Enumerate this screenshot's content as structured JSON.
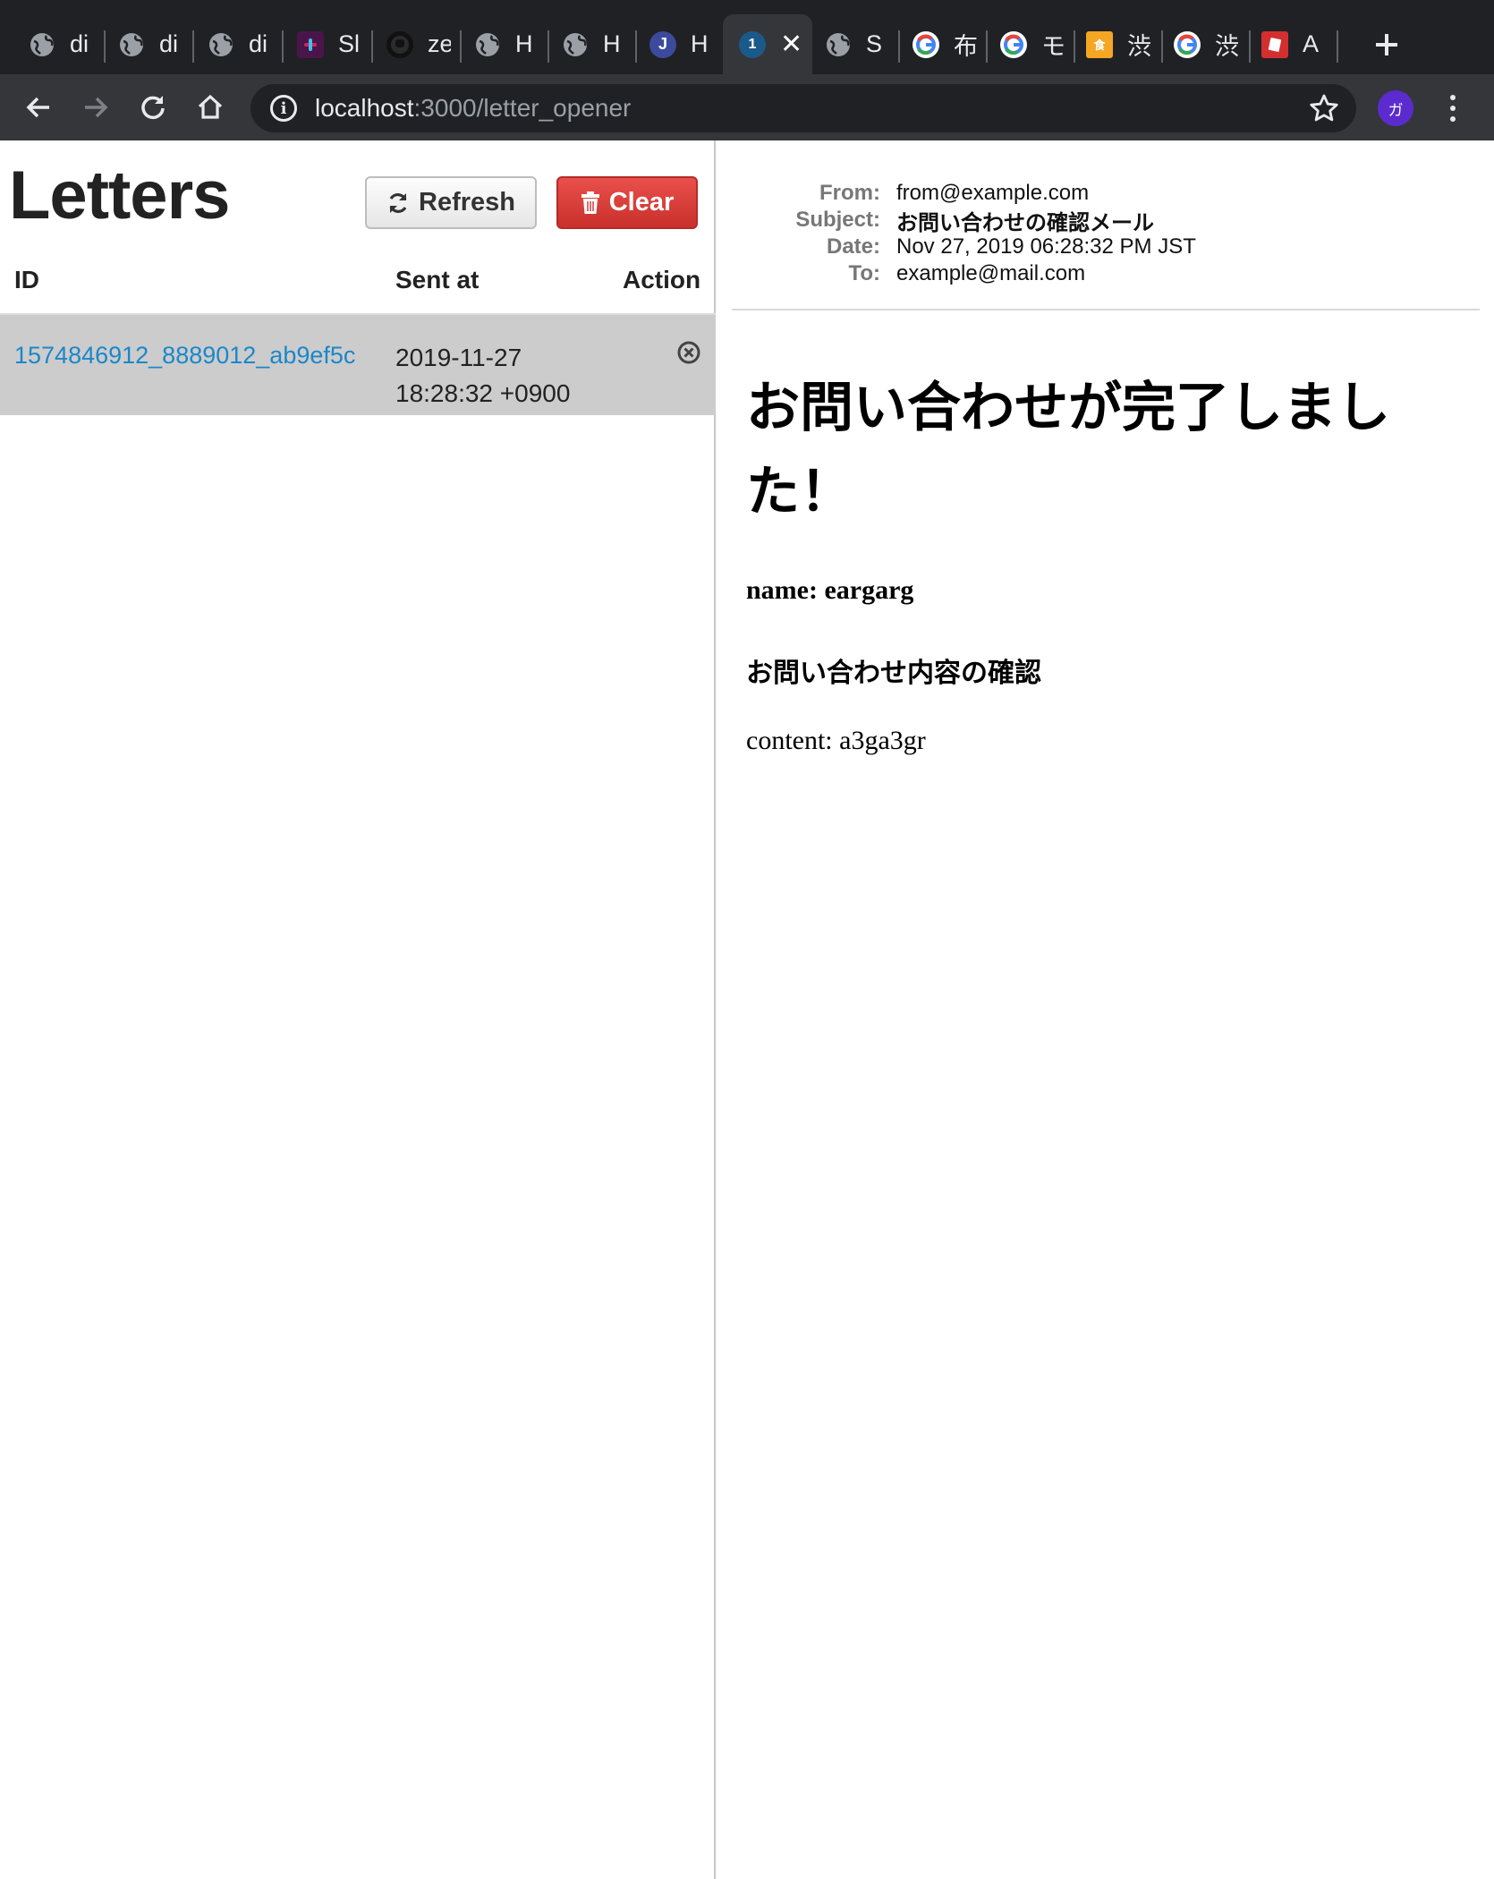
{
  "browser": {
    "tabs": [
      {
        "icon": "globe-icon",
        "title": "di"
      },
      {
        "icon": "globe-icon",
        "title": "di"
      },
      {
        "icon": "globe-icon",
        "title": "di"
      },
      {
        "icon": "slack-icon",
        "title": "Sl"
      },
      {
        "icon": "github-icon",
        "title": "ze"
      },
      {
        "icon": "globe-icon",
        "title": "H"
      },
      {
        "icon": "globe-icon",
        "title": "H"
      },
      {
        "icon": "j-icon",
        "title": "H"
      },
      {
        "icon": "onepassword-icon",
        "title": "",
        "active": true
      },
      {
        "icon": "globe-icon",
        "title": "S"
      },
      {
        "icon": "google-icon",
        "title": "布"
      },
      {
        "icon": "google-icon",
        "title": "モ"
      },
      {
        "icon": "tabelog-icon",
        "title": "渋"
      },
      {
        "icon": "google-icon",
        "title": "渋"
      },
      {
        "icon": "red-app-icon",
        "title": "A"
      }
    ],
    "url_host": "localhost",
    "url_path": ":3000/letter_opener",
    "profile_initial": "ガ",
    "colors": {
      "frame": "#202124",
      "toolbar": "#35363a",
      "profile": "#5b2bd0"
    }
  },
  "letters": {
    "title": "Letters",
    "refresh_label": "Refresh",
    "clear_label": "Clear",
    "columns": {
      "id": "ID",
      "sent_at": "Sent at",
      "action": "Action"
    },
    "rows": [
      {
        "id": "1574846912_8889012_ab9ef5c",
        "date": "2019-11-27",
        "time": "18:28:32 +0900"
      }
    ],
    "colors": {
      "link": "#1b87c9",
      "selected_row": "#cccccc",
      "clear_button": "#d9534f"
    }
  },
  "message": {
    "headers": {
      "from_label": "From:",
      "from": "from@example.com",
      "subject_label": "Subject:",
      "subject": "お問い合わせの確認メール",
      "date_label": "Date:",
      "date": "Nov 27, 2019 06:28:32 PM JST",
      "to_label": "To:",
      "to": "example@mail.com"
    },
    "body": {
      "heading_line1": "お問い合わせが完了しまし",
      "heading_line2": "た！",
      "name_line": "name: eargarg",
      "subheading": "お問い合わせ内容の確認",
      "content_line": "content: a3ga3gr"
    }
  }
}
